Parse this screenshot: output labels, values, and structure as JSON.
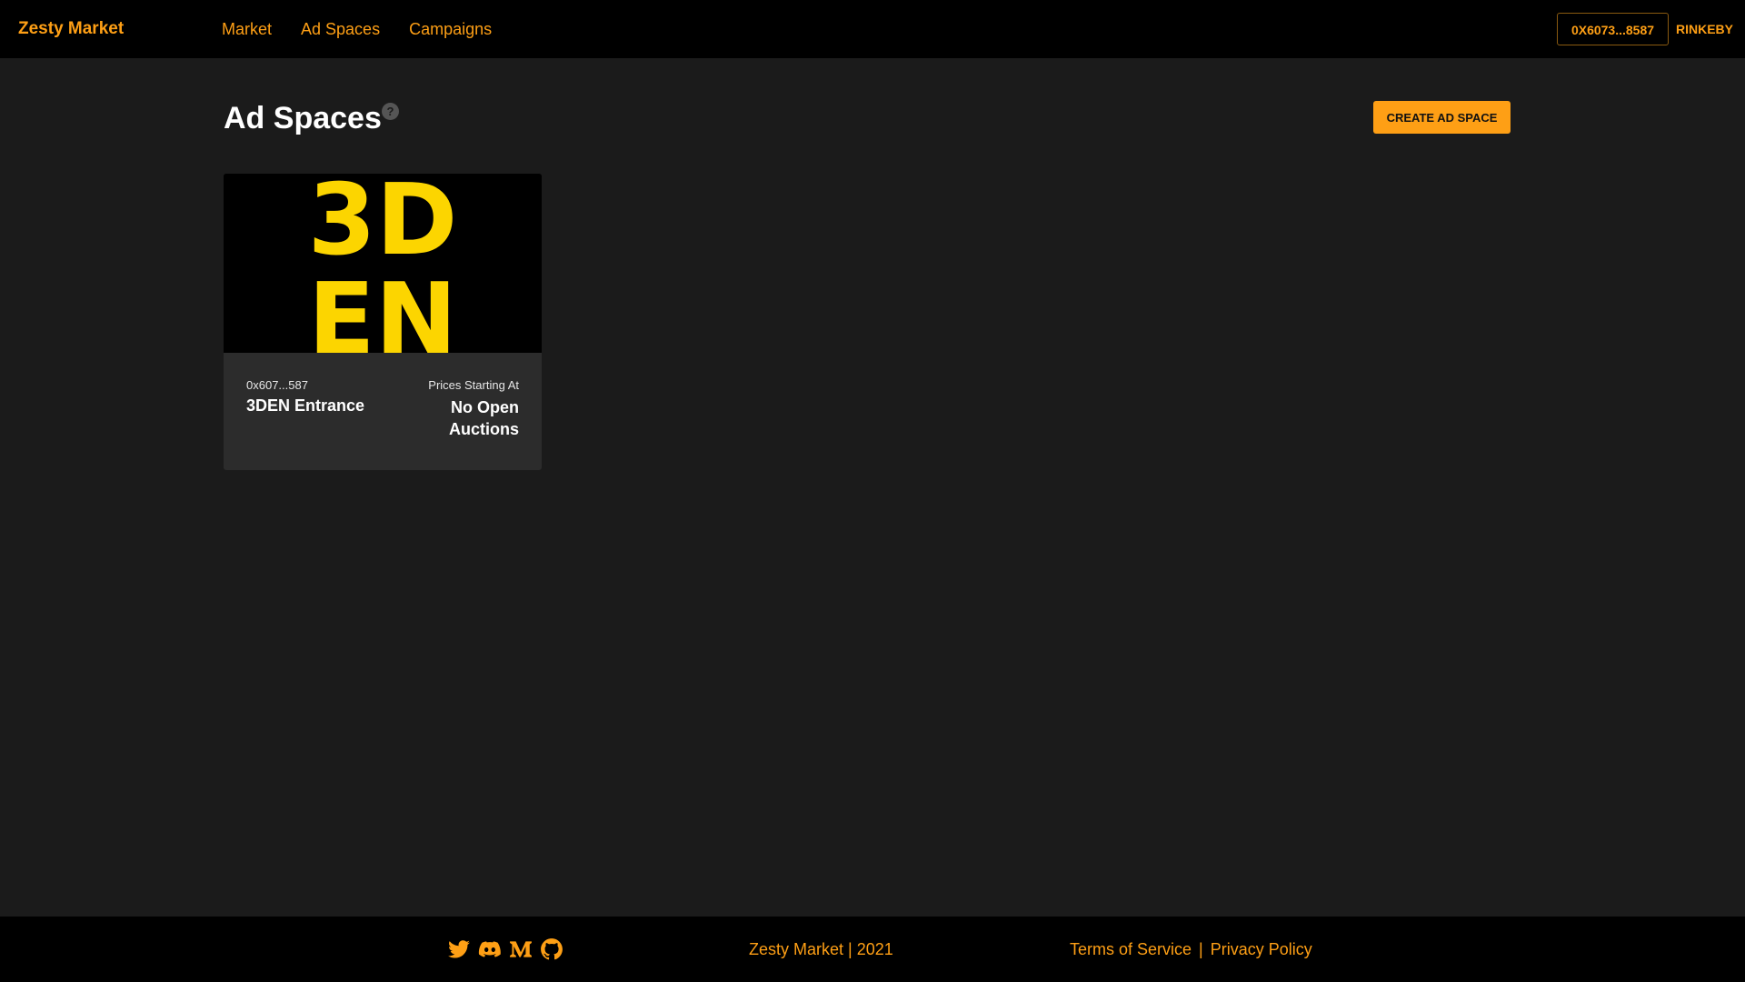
{
  "brand": {
    "name": "Zesty Market"
  },
  "nav": {
    "items": [
      {
        "label": "Market"
      },
      {
        "label": "Ad Spaces"
      },
      {
        "label": "Campaigns"
      }
    ]
  },
  "account": {
    "wallet": "0X6073...8587",
    "network": "RINKEBY"
  },
  "page": {
    "title": "Ad Spaces",
    "help_icon": "?",
    "create_label": "CREATE AD SPACE"
  },
  "cards": [
    {
      "image_text": [
        "3D",
        "EN"
      ],
      "owner": "0x607...587",
      "title": "3DEN Entrance",
      "price_label": "Prices Starting At",
      "price_value": "No Open Auctions"
    }
  ],
  "footer": {
    "socials": [
      "twitter-icon",
      "discord-icon",
      "medium-icon",
      "github-icon"
    ],
    "copyright": "Zesty Market | 2021",
    "terms": "Terms of Service",
    "separator": "|",
    "privacy": "Privacy Policy"
  },
  "colors": {
    "accent": "#fe9f15",
    "logo_yellow": "#fcd500",
    "background": "#1b1b1b",
    "bar": "#000000",
    "card": "#2c2c2c"
  }
}
